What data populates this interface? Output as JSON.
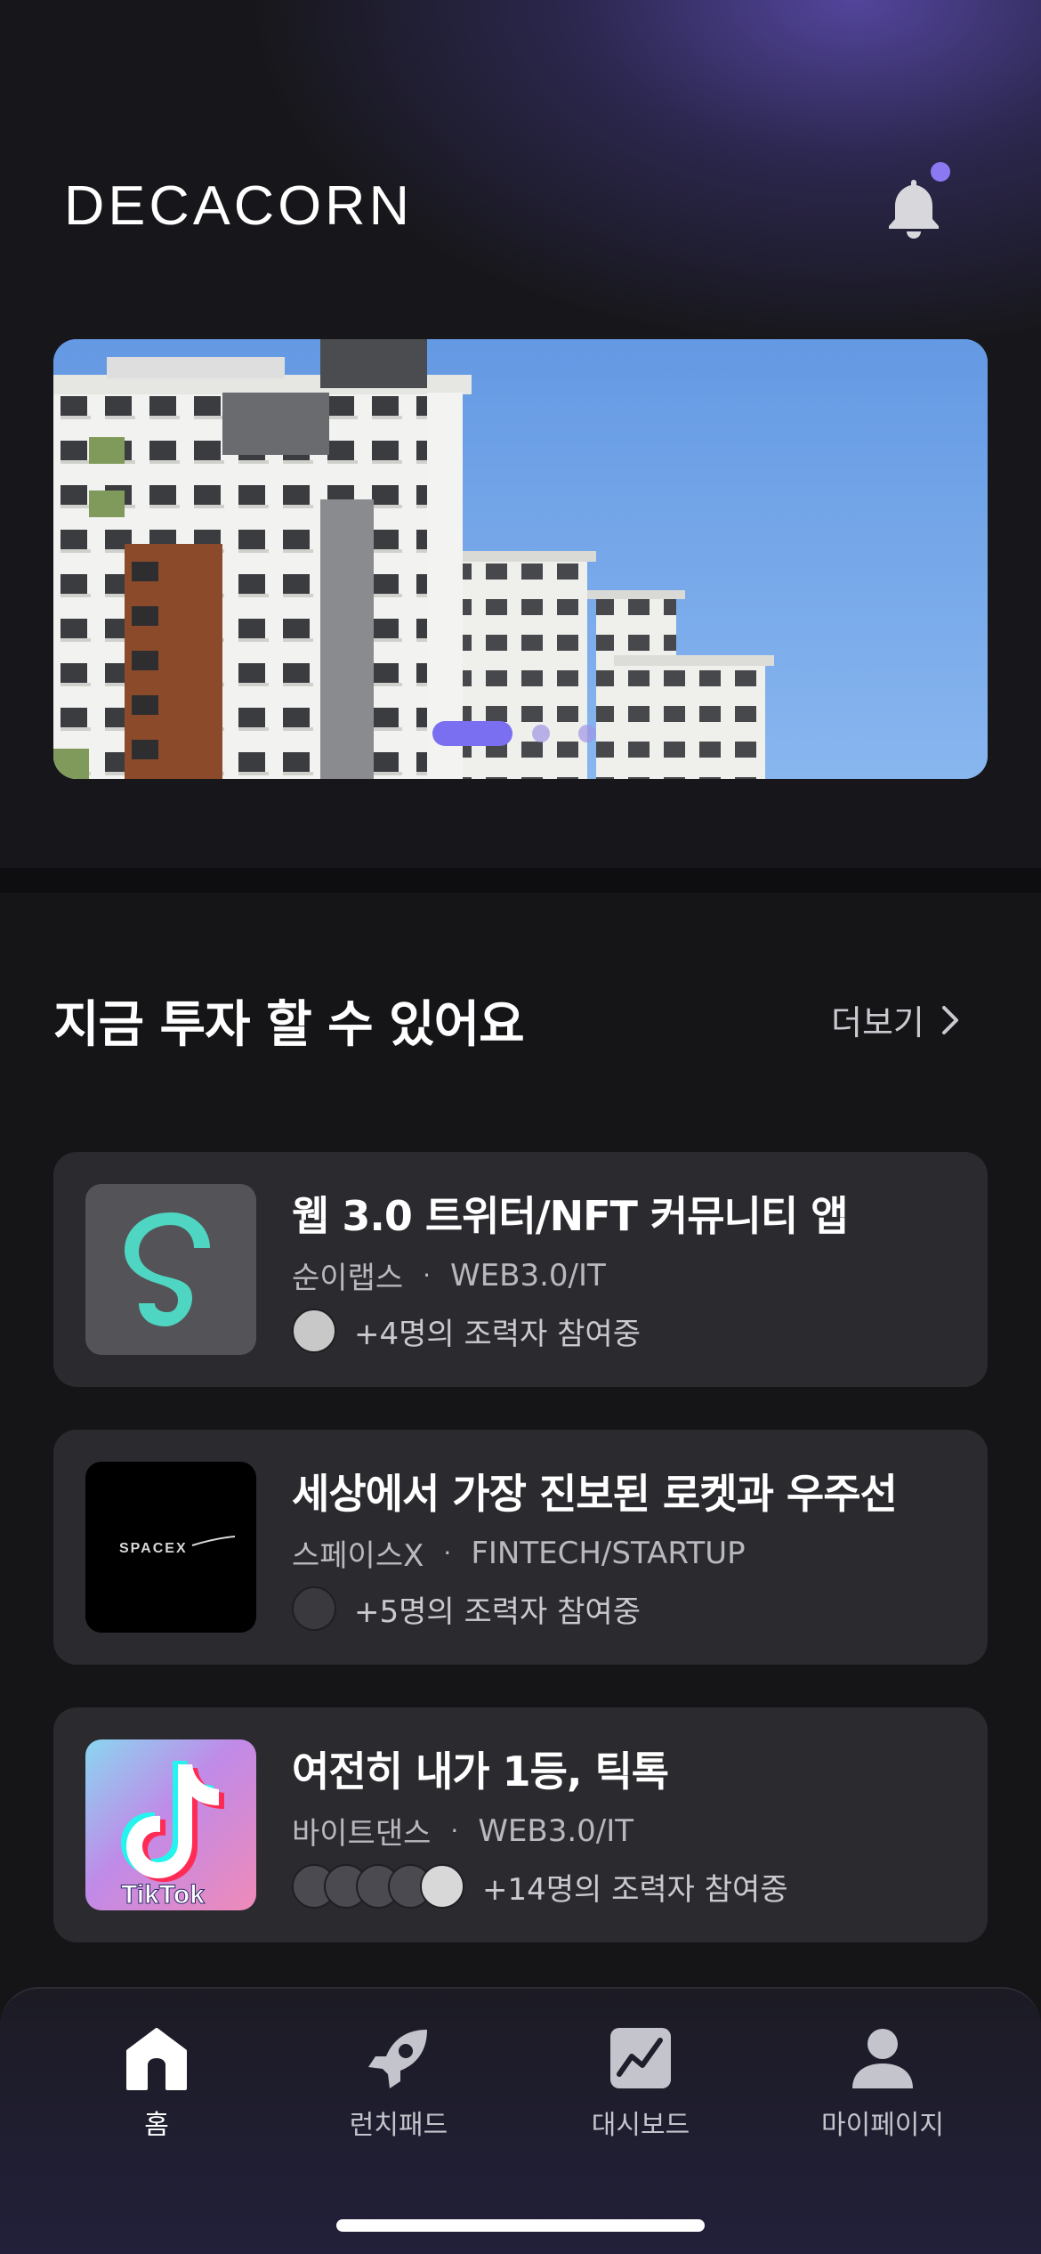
{
  "header": {
    "logo_text": "DECACORN",
    "notification_badge": true,
    "accent_color": "#8a79f2"
  },
  "banner": {
    "slide_count": 3,
    "active_slide": 1
  },
  "section": {
    "title": "지금 투자 할 수 있어요",
    "more_label": "더보기"
  },
  "cards": [
    {
      "title": "웹 3.0 트위터/NFT 커뮤니티 앱",
      "company": "순이랩스",
      "category": "WEB3.0/IT",
      "participants": "+4명의 조력자 참여중",
      "avatar_count": 1,
      "icon": "soonilabs-logo-icon"
    },
    {
      "title": "세상에서 가장 진보된 로켓과 우주선",
      "company": "스페이스X",
      "category": "FINTECH/STARTUP",
      "participants": "+5명의 조력자 참여중",
      "avatar_count": 1,
      "logo_text": "SPACEX",
      "icon": "spacex-logo-icon"
    },
    {
      "title": "여전히 내가 1등, 틱톡",
      "company": "바이트댄스",
      "category": "WEB3.0/IT",
      "participants": "+14명의 조력자 참여중",
      "avatar_count": 5,
      "logo_text": "TikTok",
      "icon": "tiktok-logo-icon"
    }
  ],
  "bottom_nav": {
    "items": [
      {
        "label": "홈",
        "icon": "home-icon",
        "active": true
      },
      {
        "label": "런치패드",
        "icon": "rocket-icon",
        "active": false
      },
      {
        "label": "대시보드",
        "icon": "chart-icon",
        "active": false
      },
      {
        "label": "마이페이지",
        "icon": "person-icon",
        "active": false
      }
    ]
  }
}
